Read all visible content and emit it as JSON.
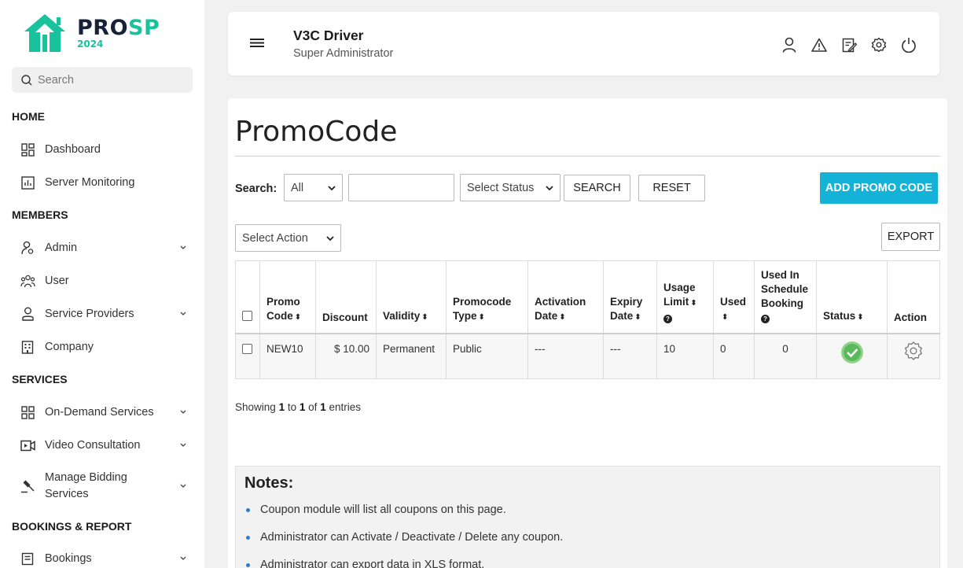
{
  "brand": {
    "name_main": "PRO",
    "name_accent": "SP",
    "year": "2024",
    "accent_color": "#18c29c"
  },
  "sidebar": {
    "search_placeholder": "Search",
    "sections": {
      "home": "HOME",
      "members": "MEMBERS",
      "services": "SERVICES",
      "bookings": "BOOKINGS & REPORT"
    },
    "items": {
      "dashboard": "Dashboard",
      "server_monitoring": "Server Monitoring",
      "admin": "Admin",
      "user": "User",
      "service_providers": "Service Providers",
      "company": "Company",
      "on_demand": "On-Demand Services",
      "video": "Video Consultation",
      "bidding_1": "Manage Bidding",
      "bidding_2": "Services",
      "bookings": "Bookings"
    }
  },
  "header": {
    "title": "V3C Driver",
    "subtitle": "Super Administrator",
    "icons": [
      "user-icon",
      "alert-icon",
      "edit-icon",
      "settings-icon",
      "power-icon"
    ]
  },
  "page": {
    "title": "PromoCode",
    "search_label": "Search:",
    "search_filter_value": "All",
    "search_input_value": "",
    "status_select_value": "Select Status",
    "search_button": "SEARCH",
    "reset_button": "RESET",
    "add_button": "ADD PROMO CODE",
    "action_select_value": "Select Action",
    "export_button": "EXPORT",
    "primary_color": "#14b2d6"
  },
  "table": {
    "headers": {
      "promo_code_1": "Promo",
      "promo_code_2": "Code",
      "discount": "Discount",
      "validity": "Validity",
      "type_1": "Promocode",
      "type_2": "Type",
      "activation_1": "Activation",
      "activation_2": "Date",
      "expiry_1": "Expiry",
      "expiry_2": "Date",
      "usage_1": "Usage",
      "usage_2": "Limit",
      "used": "Used",
      "sched_1": "Used In",
      "sched_2": "Schedule",
      "sched_3": "Booking",
      "status": "Status",
      "action": "Action"
    },
    "rows": [
      {
        "code": "NEW10",
        "discount": "$ 10.00",
        "validity": "Permanent",
        "type": "Public",
        "activation": "---",
        "expiry": "---",
        "usage_limit": "10",
        "used": "0",
        "used_schedule": "0",
        "status": "active"
      }
    ]
  },
  "showing": {
    "prefix": "Showing",
    "from": "1",
    "to_word": "to",
    "to": "1",
    "of_word": "of",
    "total": "1",
    "suffix": "entries"
  },
  "notes": {
    "title": "Notes:",
    "items": [
      "Coupon module will list all coupons on this page.",
      "Administrator can Activate / Deactivate / Delete any coupon.",
      "Administrator can export data in XLS format."
    ]
  }
}
